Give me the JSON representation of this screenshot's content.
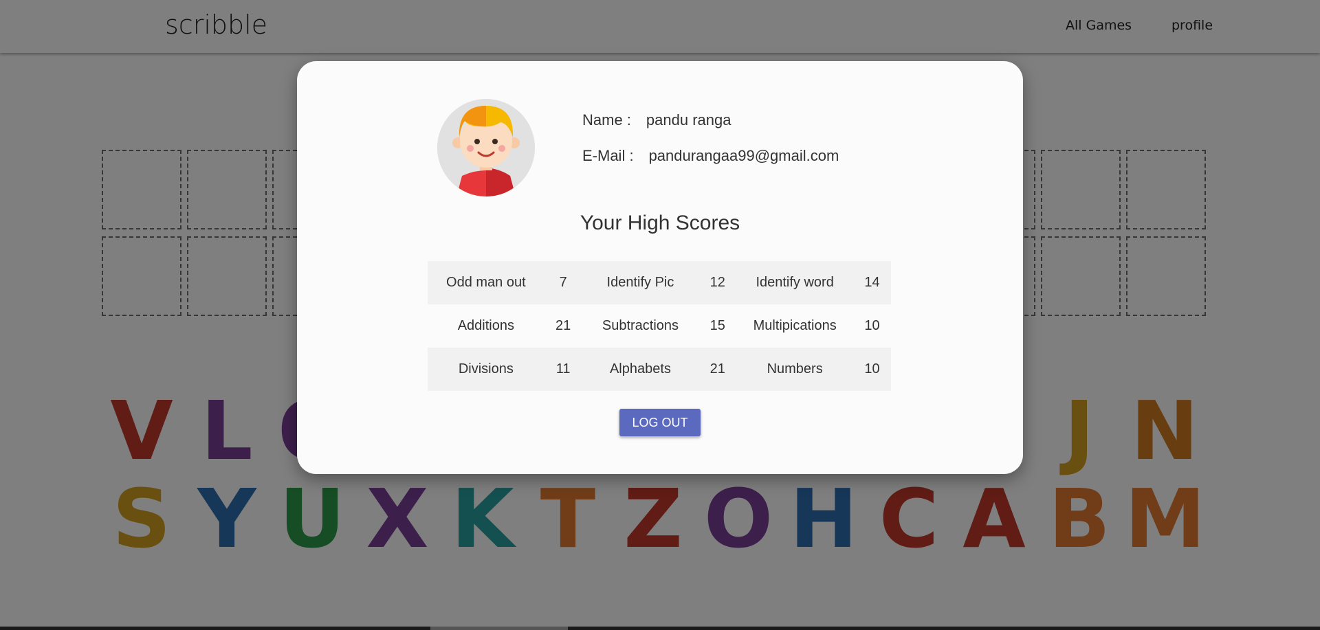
{
  "header": {
    "brand": "scribble",
    "nav": [
      {
        "label": "All Games"
      },
      {
        "label": "profile"
      }
    ]
  },
  "alphabet": {
    "row1": [
      "V",
      "L",
      "O",
      "",
      "",
      "",
      "",
      "",
      "",
      "",
      "",
      "J",
      "N"
    ],
    "row2": [
      "S",
      "Y",
      "U",
      "X",
      "K",
      "T",
      "Z",
      "O",
      "H",
      "C",
      "A",
      "B",
      "M"
    ],
    "colors_row1": [
      "#c0392b",
      "#7b3f98",
      "#7b3f98",
      "",
      "",
      "",
      "",
      "",
      "",
      "",
      "",
      "#d4a020",
      "#d07a20"
    ],
    "colors_row2": [
      "#d4a020",
      "#2f6fb2",
      "#2e9a4a",
      "#7b3f98",
      "#2aa0a0",
      "#e07a30",
      "#c0392b",
      "#7b3f98",
      "#2f6fb2",
      "#c0392b",
      "#c0392b",
      "#e07a30",
      "#e07a30"
    ]
  },
  "profile_modal": {
    "name_label": "Name :",
    "name_value": "pandu ranga",
    "email_label": "E-Mail :",
    "email_value": "pandurangaa99@gmail.com",
    "heading": "Your High Scores",
    "scores": [
      [
        {
          "game": "Odd man out",
          "score": "7"
        },
        {
          "game": "Identify Pic",
          "score": "12"
        },
        {
          "game": "Identify word",
          "score": "14"
        }
      ],
      [
        {
          "game": "Additions",
          "score": "21"
        },
        {
          "game": "Subtractions",
          "score": "15"
        },
        {
          "game": "Multipications",
          "score": "10"
        }
      ],
      [
        {
          "game": "Divisions",
          "score": "11"
        },
        {
          "game": "Alphabets",
          "score": "21"
        },
        {
          "game": "Numbers",
          "score": "10"
        }
      ]
    ],
    "logout_label": "LOG OUT",
    "avatar_icon": "boy-avatar-icon"
  },
  "colors": {
    "button": "#5b6abf",
    "overlay": "rgba(0,0,0,0.5)",
    "modal_bg": "#fbfbfb"
  }
}
